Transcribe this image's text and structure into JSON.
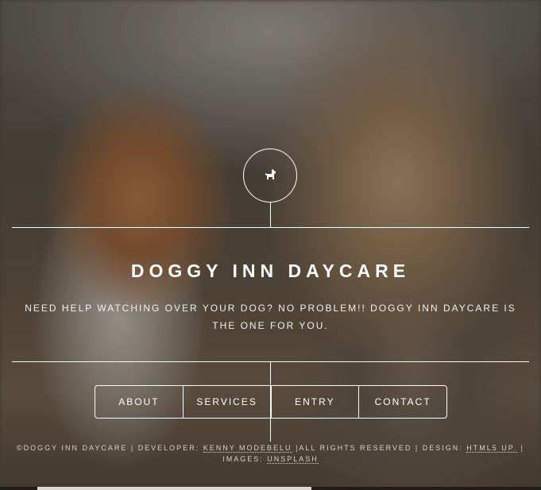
{
  "header": {
    "logo_icon": "dog-icon",
    "title": "DOGGY INN DAYCARE",
    "tagline": "NEED HELP WATCHING OVER YOUR DOG? NO PROBLEM!! DOGGY INN DAYCARE IS THE ONE FOR YOU."
  },
  "nav": {
    "items": [
      {
        "label": "ABOUT"
      },
      {
        "label": "SERVICES"
      },
      {
        "label": "ENTRY"
      },
      {
        "label": "CONTACT"
      }
    ]
  },
  "footer": {
    "copyright": "©DOGGY INN DAYCARE | DEVELOPER: ",
    "developer_link": "KENNY MODEBELU",
    "rights": " |ALL RIGHTS RESERVED | DESIGN: ",
    "design_link": "HTML5 UP.",
    "images_prefix": " | IMAGES: ",
    "images_link": "UNSPLASH"
  },
  "colors": {
    "text": "#ffffff",
    "footer_text": "#d6d2cc",
    "overlay": "#1c1a18"
  }
}
